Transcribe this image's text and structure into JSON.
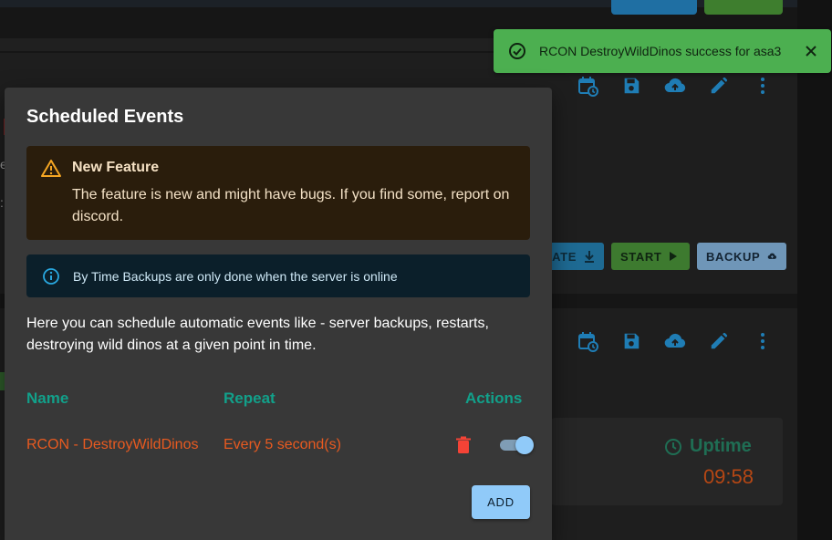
{
  "background": {
    "action_buttons": {
      "update_label": "ATE",
      "start_label": "START",
      "backup_label": "BACKUP"
    },
    "uptime": {
      "label": "Uptime",
      "value": "09:58"
    },
    "peek_text": {
      "e": "e",
      "colon": ":"
    }
  },
  "toast": {
    "message": "RCON DestroyWildDinos success for asa3",
    "icon": "check-circle-icon",
    "close_icon": "close-icon",
    "color": "#4caf50"
  },
  "modal": {
    "title": "Scheduled Events",
    "warning": {
      "title": "New Feature",
      "body": "The feature is new and might have bugs. If you find some, report on discord.",
      "icon": "warning-icon"
    },
    "info": {
      "text": "By Time Backups are only done when the server is online",
      "icon": "info-icon"
    },
    "description": "Here you can schedule automatic events like - server backups, restarts, destroying wild dinos at a given point in time.",
    "table": {
      "headers": {
        "name": "Name",
        "repeat": "Repeat",
        "actions": "Actions"
      },
      "rows": [
        {
          "name": "RCON - DestroyWildDinos",
          "repeat": "Every 5 second(s)",
          "enabled": true
        }
      ]
    },
    "add_label": "ADD"
  },
  "colors": {
    "accent": "#90caf9",
    "header_teal": "#12a08a",
    "row_orange": "#e85a20",
    "delete_red": "#f44336",
    "toolbar_blue": "#1f7db5"
  }
}
